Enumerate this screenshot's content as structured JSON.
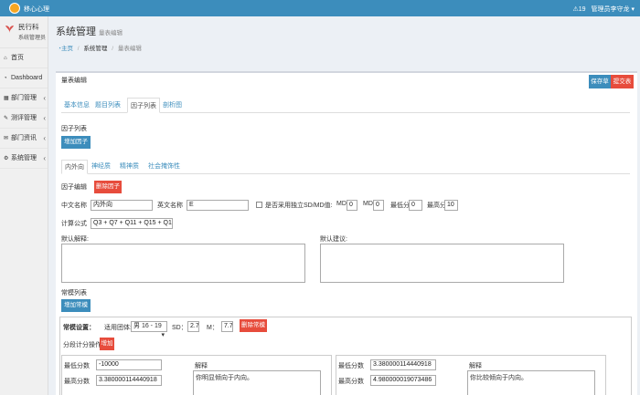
{
  "topbar": {
    "brand": "移心心理",
    "badge": "19",
    "user": "管理员李守龙"
  },
  "sidebar": {
    "profile_name": "民行科",
    "profile_role": "系统管理员",
    "items": [
      {
        "label": "首页",
        "icon": "home-icon",
        "chevron": ""
      },
      {
        "label": "Dashboard",
        "icon": "dashboard-icon",
        "chevron": ""
      },
      {
        "label": "部门管理",
        "icon": "grid-icon",
        "chevron": "‹"
      },
      {
        "label": "测评管理",
        "icon": "edit-icon",
        "chevron": "‹"
      },
      {
        "label": "部门资讯",
        "icon": "mail-icon",
        "chevron": "‹"
      },
      {
        "label": "系统管理",
        "icon": "gear-icon",
        "chevron": "‹"
      }
    ]
  },
  "header": {
    "title": "系统管理",
    "subtitle": "量表编辑",
    "breadcrumb": [
      "主页",
      "系统管理",
      "量表编辑"
    ]
  },
  "box": {
    "title": "量表编辑",
    "save_label": "保存草稿",
    "submit_label": "提交表单",
    "tabs": [
      "基本信息",
      "题目列表",
      "因子列表",
      "剖析图"
    ],
    "active_tab": 2
  },
  "factor": {
    "list_label": "因子列表",
    "add_label": "增加因子",
    "subtabs": [
      "内外向",
      "神经质",
      "精神质",
      "社会掩饰性"
    ],
    "edit_label": "因子编辑",
    "delete_label": "删除因子",
    "cn_name_label": "中文名称",
    "cn_name_value": "内外向",
    "en_name_label": "英文名称",
    "en_name_value": "E",
    "independent_label": "是否采用独立SD/MD值:",
    "md_label1": "MD",
    "md_value1": "0",
    "md_label2": "MD",
    "md_value2": "0",
    "min_label": "最低分",
    "min_value": "0",
    "max_label": "最高分",
    "max_value": "10",
    "formula_label": "计算公式",
    "formula_value": "Q3 + Q7 + Q11 + Q15 + Q19",
    "default_explain_label": "默认解释:",
    "default_advice_label": "默认建议:"
  },
  "norms": {
    "list_label": "常模列表",
    "add_label": "增加常模",
    "setting_label": "常模设置：",
    "group_label": "适用团体:",
    "group_value": "男 16 - 19",
    "sd_label": "SD：",
    "sd_value": "2.7",
    "m_label": "M：",
    "m_value": "7.7",
    "delete_label": "删除常模",
    "segment_label": "分段计分操作:",
    "segment_add": "增加",
    "left": {
      "min_label": "最低分数",
      "min_value": "-10000",
      "max_label": "最高分数",
      "max_value": "3.380000114440918",
      "explain_label": "解释",
      "explain_text": "你明显倾向于内向。"
    },
    "right": {
      "min_label": "最低分数",
      "min_value": "3.380000114440918",
      "max_label": "最高分数",
      "max_value": "4.980000019073486",
      "explain_label": "解释",
      "explain_text": "你比较倾向于内向。"
    }
  }
}
